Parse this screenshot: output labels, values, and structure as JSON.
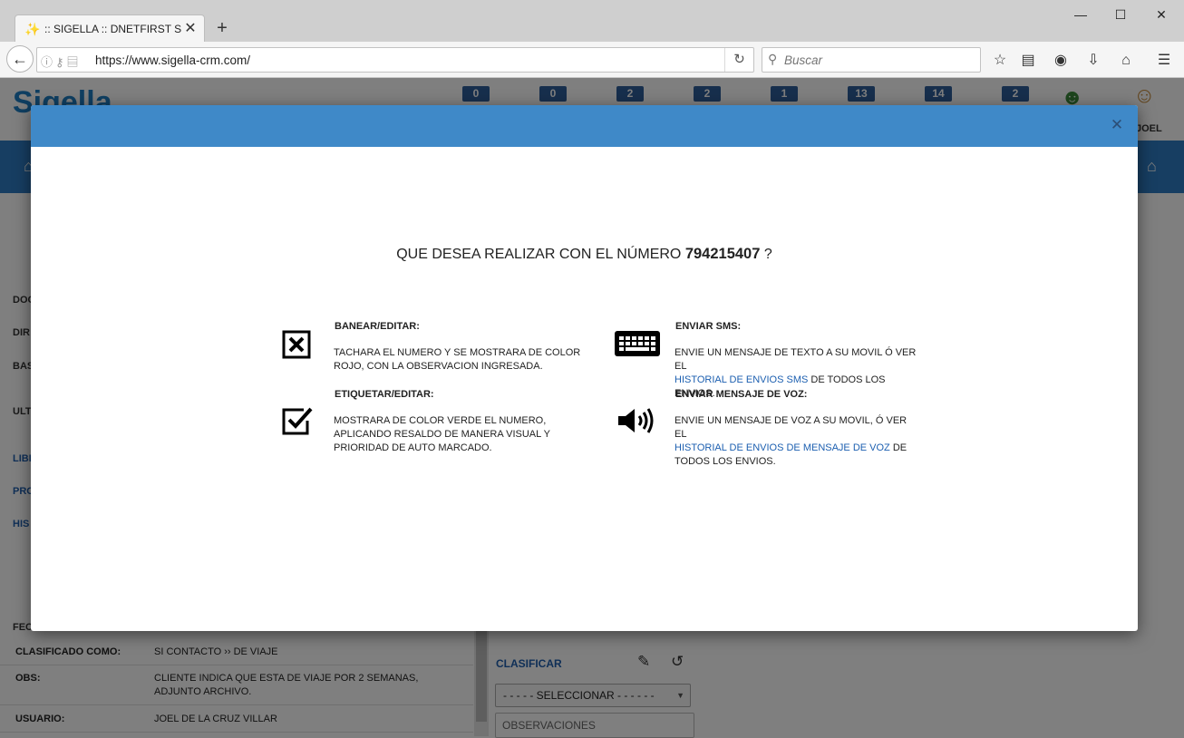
{
  "browser": {
    "tab_title": ":: SIGELLA :: DNETFIRST S....",
    "url": "https://www.sigella-crm.com/",
    "search_placeholder": "Buscar"
  },
  "app": {
    "logo": "Sigella",
    "counters": [
      "0",
      "0",
      "2",
      "2",
      "1",
      "13",
      "14",
      "2"
    ],
    "user_short": "JOEL"
  },
  "background": {
    "side_labels": [
      "DOC",
      "DIR",
      "BAS",
      "ULT"
    ],
    "side_links": [
      "LIBR",
      "PRO",
      "HIS"
    ],
    "fec_label": "FEC",
    "rows": [
      {
        "label": "CLASIFICADO COMO:",
        "value": "SI CONTACTO ›› DE VIAJE"
      },
      {
        "label": "OBS:",
        "value": "CLIENTE INDICA QUE ESTA DE VIAJE POR 2 SEMANAS, ADJUNTO ARCHIVO."
      },
      {
        "label": "USUARIO:",
        "value": "JOEL DE LA CRUZ VILLAR"
      }
    ],
    "classify_title": "CLASIFICAR",
    "select_value": "- - - - - SELECCIONAR - - - - - -",
    "obs_placeholder": "OBSERVACIONES"
  },
  "modal": {
    "question_prefix": "QUE DESEA REALIZAR CON EL NÚMERO",
    "number": "794215407",
    "question_suffix": "?",
    "options": {
      "ban": {
        "icon": "x-box-icon",
        "title": "BANEAR/EDITAR:",
        "desc": "TACHARA EL NUMERO Y SE MOSTRARA DE COLOR ROJO, CON LA OBSERVACION INGRESADA."
      },
      "tag": {
        "icon": "check-box-icon",
        "title": "ETIQUETAR/EDITAR:",
        "desc": "MOSTRARA DE COLOR VERDE EL NUMERO, APLICANDO RESALDO DE MANERA VISUAL Y PRIORIDAD DE AUTO MARCADO."
      },
      "sms": {
        "icon": "keyboard-icon",
        "title": "ENVIAR SMS:",
        "desc_pre": "ENVIE UN MENSAJE DE TEXTO A SU MOVIL Ó VER EL",
        "link": "HISTORIAL DE ENVIOS SMS",
        "desc_post": "DE TODOS LOS ENVIOS."
      },
      "voice": {
        "icon": "speaker-icon",
        "title": "ENVIAR MENSAJE DE VOZ:",
        "desc_pre": "ENVIE UN MENSAJE DE VOZ A SU MOVIL, Ó VER EL",
        "link": "HISTORIAL DE ENVIOS DE MENSAJE DE VOZ",
        "desc_post": "DE TODOS LOS ENVIOS."
      }
    },
    "colors": {
      "header": "#3f89c8",
      "link": "#1c5fb0"
    }
  }
}
